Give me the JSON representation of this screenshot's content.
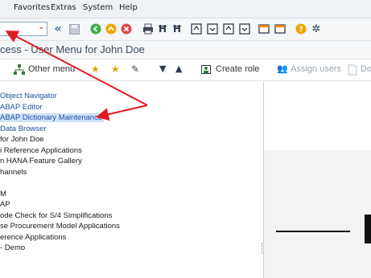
{
  "menubar": {
    "items": [
      "Favorites",
      "Extras",
      "System",
      "Help"
    ]
  },
  "toolbar": {
    "command_field_value": "",
    "icons": [
      "back-icon",
      "save-icon",
      "exit-icon",
      "cancel-icon",
      "print-icon",
      "find-icon",
      "find-next-icon",
      "first-page-icon",
      "previous-page-icon",
      "next-page-icon",
      "last-page-icon",
      "new-session-icon",
      "shortcut-icon",
      "help-icon",
      "settings-icon"
    ]
  },
  "title": {
    "text": "cess - User Menu for John Doe"
  },
  "app_toolbar": {
    "other_menu_label": "Other menu",
    "create_role_label": "Create role",
    "assign_users_label": "Assign users",
    "truncated_label": "Do"
  },
  "tree": {
    "nodes": [
      {
        "label": "Object Navigator",
        "link": true
      },
      {
        "label": "ABAP Editor",
        "link": true
      },
      {
        "label": "ABAP Dictionary Maintenance",
        "link": true,
        "selected": true
      },
      {
        "label": "Data Browser",
        "link": true
      },
      {
        "label": "for John Doe",
        "link": false
      },
      {
        "label": "i Reference Applications",
        "link": false
      },
      {
        "label": "n HANA Feature Gallery",
        "link": false
      },
      {
        "label": "hannels",
        "link": false
      },
      {
        "label": "",
        "link": false
      },
      {
        "label": "M",
        "link": false
      },
      {
        "label": "AP",
        "link": false
      },
      {
        "label": "ode Check for S/4 Simplifications",
        "link": false
      },
      {
        "label": "se Procurement Model Applications",
        "link": false
      },
      {
        "label": "erence Applications",
        "link": false
      },
      {
        "label": " - Demo",
        "link": false
      }
    ]
  },
  "colors": {
    "annotation_arrow": "#e21b23",
    "link": "#1f4fa0",
    "selection": "#cfe3f7"
  }
}
